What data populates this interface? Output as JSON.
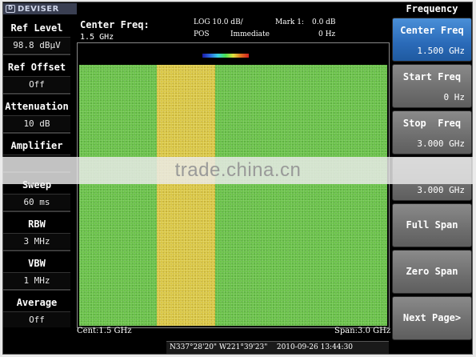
{
  "brand": {
    "logo_glyph": "D",
    "name": "DEVISER"
  },
  "left_params": [
    {
      "label": "Ref Level",
      "value": "98.8 dBµV"
    },
    {
      "label": "Ref Offset",
      "value": "Off"
    },
    {
      "label": "Attenuation",
      "value": "10 dB"
    },
    {
      "label": "Amplifier",
      "value": ""
    },
    {
      "label": "Sweep",
      "value": "60 ms"
    },
    {
      "label": "RBW",
      "value": "3 MHz"
    },
    {
      "label": "VBW",
      "value": "1 MHz"
    },
    {
      "label": "Average",
      "value": "Off"
    }
  ],
  "header": {
    "center_freq_label": "Center Freq:",
    "center_freq_value": "1.5 GHz",
    "scale": "LOG 10.0 dB/",
    "detector": "POS",
    "trigger": "Immediate",
    "marker_label": "Mark 1:",
    "marker_level": "0.0 dB",
    "marker_freq": "0 Hz"
  },
  "plot": {
    "footer_left": "Cent:1.5 GHz",
    "footer_right": "Span:3.0 GHz",
    "background_color": "#6bc24a",
    "band_color": "#d9c645",
    "band_start_fraction": 0.252,
    "band_end_fraction": 0.441
  },
  "status_bar": {
    "location": "N337°28'20\" W221°39'23\"",
    "datetime": "2010-09-26 13:44:30"
  },
  "menu": {
    "title": "Frequency",
    "softkeys": [
      {
        "label": "Center Freq",
        "value": "1.500 GHz",
        "active": true
      },
      {
        "label": "Start Freq",
        "value": "0 Hz",
        "active": false
      },
      {
        "label": "Stop  Freq",
        "value": "3.000 GHz",
        "active": false
      },
      {
        "label": "",
        "value": "3.000 GHz",
        "active": false
      },
      {
        "label": "Full Span",
        "value": "",
        "active": false
      },
      {
        "label": "Zero Span",
        "value": "",
        "active": false
      },
      {
        "label": "Next Page>",
        "value": "",
        "active": false
      }
    ]
  },
  "watermark": "trade.china.cn",
  "colors": {
    "accent": "#2a6ab8",
    "softkey": "#6e6e6e",
    "screen_bg": "#000000"
  }
}
